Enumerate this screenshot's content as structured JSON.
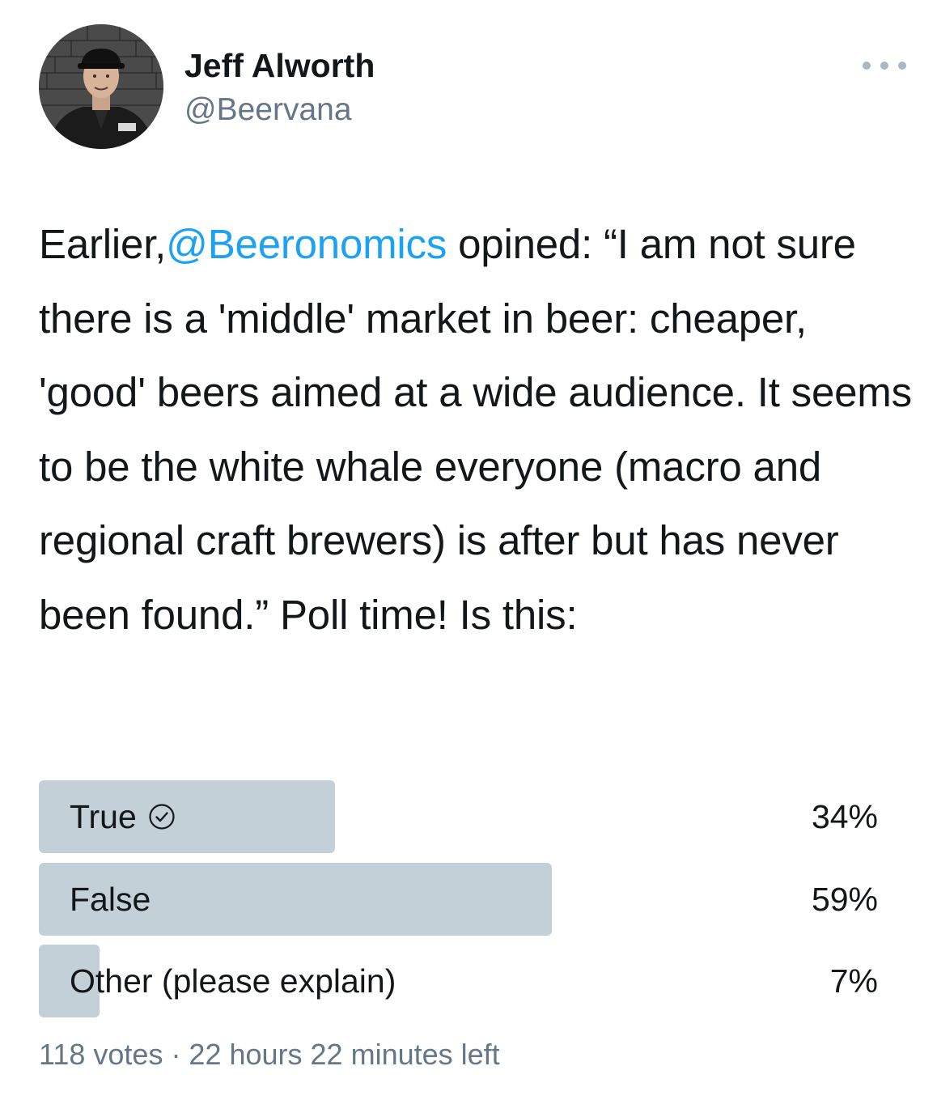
{
  "author": {
    "name": "Jeff Alworth",
    "handle": "@Beervana",
    "avatar_icon": "person-photo-avatar"
  },
  "more_icon": "more-horizontal-icon",
  "tweet": {
    "prefix": "Earlier,",
    "mention": "@Beeronomics",
    "body": " opined: “I am not sure there is a 'middle' market in beer: cheaper, 'good' beers aimed at a wide audience. It seems to be the white whale everyone (macro and regional craft brewers) is after but has never been found.” Poll time! Is this:"
  },
  "poll": {
    "options": [
      {
        "label": "True",
        "percent_text": "34%",
        "percent": 34,
        "selected": true
      },
      {
        "label": "False",
        "percent_text": "59%",
        "percent": 59,
        "selected": false
      },
      {
        "label": "Other (please explain)",
        "percent_text": "7%",
        "percent": 7,
        "selected": false
      }
    ],
    "meta": "118 votes · 22 hours 22 minutes left"
  },
  "colors": {
    "text": "#14171a",
    "secondary": "#657786",
    "link": "#1da1f2",
    "bar": "#c4d0d8"
  }
}
